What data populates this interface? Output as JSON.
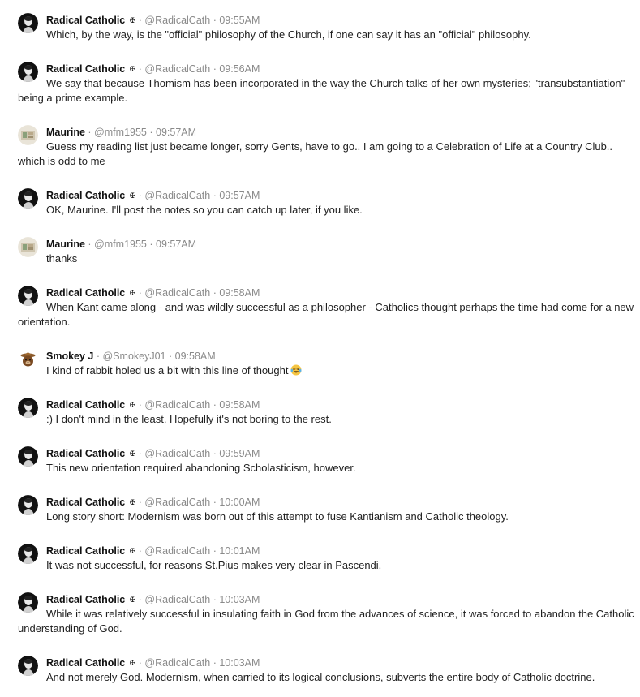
{
  "messages": [
    {
      "author": "Radical Catholic",
      "badge": "✠",
      "sep1": "·",
      "handle": "@RadicalCath",
      "sep2": "·",
      "time": "09:55AM",
      "avatar": "radicalcath-avatar",
      "text": "Which, by the way, is the \"official\" philosophy of the Church, if one can say it has an \"official\" philosophy."
    },
    {
      "author": "Radical Catholic",
      "badge": "✠",
      "sep1": "·",
      "handle": "@RadicalCath",
      "sep2": "·",
      "time": "09:56AM",
      "avatar": "radicalcath-avatar",
      "text": "We say that because Thomism has been incorporated in the way the Church talks of her own mysteries; \"transubstantiation\" being a prime example."
    },
    {
      "author": "Maurine",
      "badge": "",
      "sep1": "·",
      "handle": "@mfm1955",
      "sep2": "·",
      "time": "09:57AM",
      "avatar": "maurine-avatar",
      "text": "Guess my reading list just became longer, sorry Gents, have to go.. I am going to a Celebration of Life at a Country Club.. which is odd to me"
    },
    {
      "author": "Radical Catholic",
      "badge": "✠",
      "sep1": "·",
      "handle": "@RadicalCath",
      "sep2": "·",
      "time": "09:57AM",
      "avatar": "radicalcath-avatar",
      "text": "OK, Maurine. I'll post the notes so you can catch up later, if you like."
    },
    {
      "author": "Maurine",
      "badge": "",
      "sep1": "·",
      "handle": "@mfm1955",
      "sep2": "·",
      "time": "09:57AM",
      "avatar": "maurine-avatar",
      "text": "thanks"
    },
    {
      "author": "Radical Catholic",
      "badge": "✠",
      "sep1": "·",
      "handle": "@RadicalCath",
      "sep2": "·",
      "time": "09:58AM",
      "avatar": "radicalcath-avatar",
      "text": "When Kant came along - and was wildly successful as a philosopher - Catholics thought perhaps the time had come for a new orientation."
    },
    {
      "author": "Smokey J",
      "badge": "",
      "sep1": "·",
      "handle": "@SmokeyJ01",
      "sep2": "·",
      "time": "09:58AM",
      "avatar": "smokey-bear-avatar",
      "text": "I kind of rabbit holed us a bit with this line of thought",
      "emoji": "laughing-tears-emoji"
    },
    {
      "author": "Radical Catholic",
      "badge": "✠",
      "sep1": "·",
      "handle": "@RadicalCath",
      "sep2": "·",
      "time": "09:58AM",
      "avatar": "radicalcath-avatar",
      "text": ":) I don't mind in the least. Hopefully it's not boring to the rest."
    },
    {
      "author": "Radical Catholic",
      "badge": "✠",
      "sep1": "·",
      "handle": "@RadicalCath",
      "sep2": "·",
      "time": "09:59AM",
      "avatar": "radicalcath-avatar",
      "text": "This new orientation required abandoning Scholasticism, however."
    },
    {
      "author": "Radical Catholic",
      "badge": "✠",
      "sep1": "·",
      "handle": "@RadicalCath",
      "sep2": "·",
      "time": "10:00AM",
      "avatar": "radicalcath-avatar",
      "text": "Long story short: Modernism was born out of this attempt to fuse Kantianism and Catholic theology."
    },
    {
      "author": "Radical Catholic",
      "badge": "✠",
      "sep1": "·",
      "handle": "@RadicalCath",
      "sep2": "·",
      "time": "10:01AM",
      "avatar": "radicalcath-avatar",
      "text": "It was not successful, for reasons St.Pius makes very clear in Pascendi."
    },
    {
      "author": "Radical Catholic",
      "badge": "✠",
      "sep1": "·",
      "handle": "@RadicalCath",
      "sep2": "·",
      "time": "10:03AM",
      "avatar": "radicalcath-avatar",
      "text": "While it was relatively successful in insulating faith in God from the advances of science, it was forced to abandon the Catholic understanding of God."
    },
    {
      "author": "Radical Catholic",
      "badge": "✠",
      "sep1": "·",
      "handle": "@RadicalCath",
      "sep2": "·",
      "time": "10:03AM",
      "avatar": "radicalcath-avatar",
      "text": "And not merely God. Modernism, when carried to its logical conclusions, subverts the entire body of Catholic doctrine."
    }
  ]
}
